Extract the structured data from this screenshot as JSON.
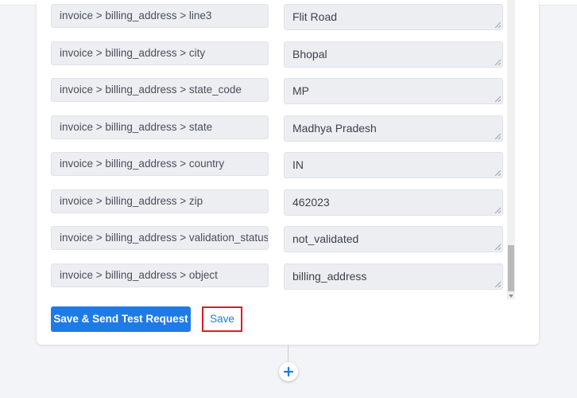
{
  "mappings": [
    {
      "field": "invoice > billing_address > line3",
      "value": "Flit Road"
    },
    {
      "field": "invoice > billing_address > city",
      "value": "Bhopal"
    },
    {
      "field": "invoice > billing_address > state_code",
      "value": "MP"
    },
    {
      "field": "invoice > billing_address > state",
      "value": "Madhya Pradesh"
    },
    {
      "field": "invoice > billing_address > country",
      "value": "IN"
    },
    {
      "field": "invoice > billing_address > zip",
      "value": "462023"
    },
    {
      "field": "invoice > billing_address > validation_status",
      "value": "not_validated"
    },
    {
      "field": "invoice > billing_address > object",
      "value": "billing_address"
    }
  ],
  "actions": {
    "save_send_label": "Save & Send Test Request",
    "save_label": "Save"
  },
  "icons": {
    "add_step": "plus-icon",
    "resize": "resize-grip-icon"
  },
  "colors": {
    "primary": "#1e7be6",
    "highlight_border": "#e11b22"
  }
}
